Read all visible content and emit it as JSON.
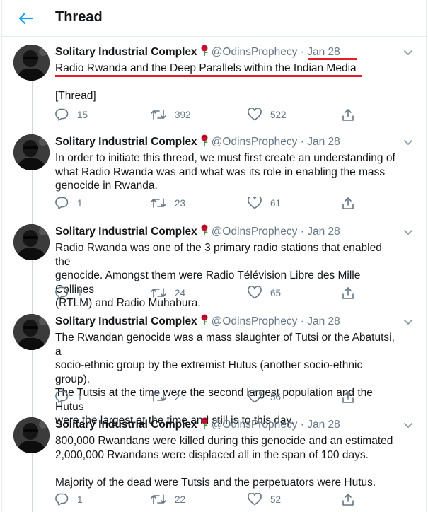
{
  "header": {
    "title": "Thread"
  },
  "colors": {
    "accent": "#1da1f2",
    "rose": "#c8102e",
    "highlight": "#e0212a"
  },
  "tweets": [
    {
      "name": "Solitary Industrial Complex",
      "handle": "@OdinsProphecy",
      "dot": "·",
      "date": "Jan 28",
      "lines": [
        "Radio Rwanda and the Deep Parallels within the Indian Media",
        "",
        "[Thread]"
      ],
      "replies": "15",
      "retweets": "392",
      "likes": "522"
    },
    {
      "name": "Solitary Industrial Complex",
      "handle": "@OdinsProphecy",
      "dot": "·",
      "date": "Jan 28",
      "lines": [
        "In order to initiate this thread, we must first create an understanding of",
        "what Radio Rwanda was and what was its role in enabling the mass",
        "genocide in Rwanda."
      ],
      "replies": "1",
      "retweets": "23",
      "likes": "61"
    },
    {
      "name": "Solitary Industrial Complex",
      "handle": "@OdinsProphecy",
      "dot": "·",
      "date": "Jan 28",
      "lines": [
        "Radio Rwanda was one of the 3 primary radio stations that enabled the",
        "genocide. Amongst them were Radio Télévision Libre des Mille Collines",
        "(RTLM) and Radio Muhabura."
      ],
      "replies": "1",
      "retweets": "24",
      "likes": "65"
    },
    {
      "name": "Solitary Industrial Complex",
      "handle": "@OdinsProphecy",
      "dot": "·",
      "date": "Jan 28",
      "lines": [
        "The Rwandan genocide was a mass slaughter of Tutsi or the Abatutsi, a",
        "socio-ethnic group by the extremist Hutus (another socio-ethnic group).",
        "The Tutsis at the time were the second largest population and the Hutus",
        "were the largest at the time and still is to this day."
      ],
      "replies": "1",
      "retweets": "21",
      "likes": "56"
    },
    {
      "name": "Solitary Industrial Complex",
      "handle": "@OdinsProphecy",
      "dot": "·",
      "date": "Jan 28",
      "lines": [
        "800,000 Rwandans were killed during this genocide and an estimated",
        "2,000,000 Rwandans were displaced all in the span of 100 days.",
        "",
        "Majority of the dead were Tutsis and the perpetuators were Hutus."
      ],
      "replies": "1",
      "retweets": "22",
      "likes": "52"
    }
  ]
}
